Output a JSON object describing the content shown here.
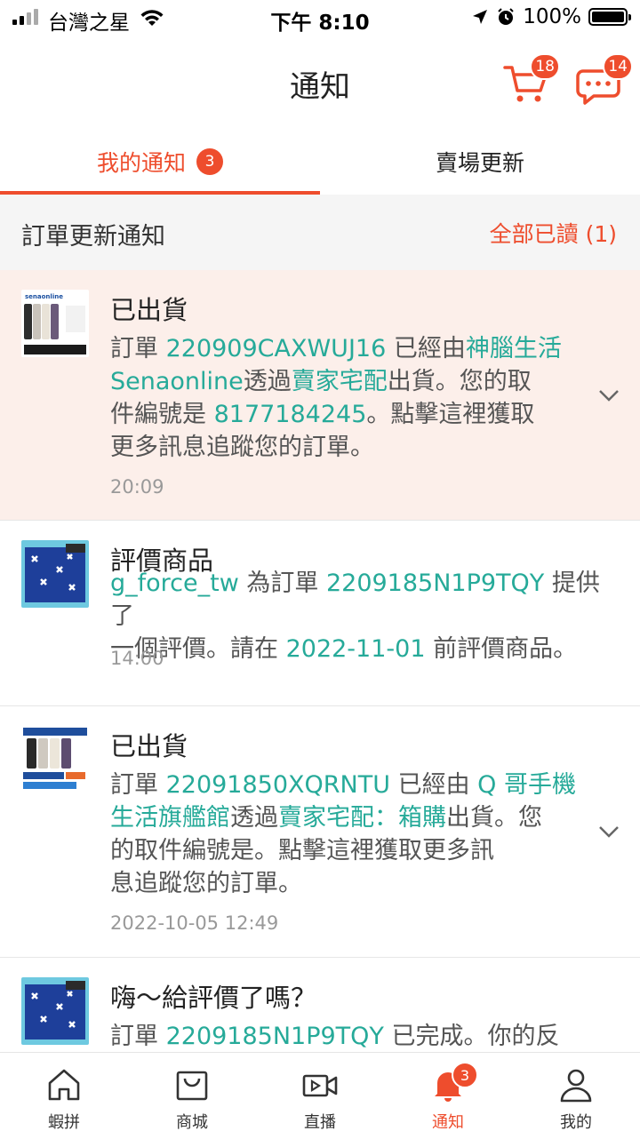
{
  "status_bar": {
    "carrier": "台灣之星",
    "time": "下午 8:10",
    "battery": "100%"
  },
  "header": {
    "title": "通知",
    "cart_badge": "18",
    "chat_badge": "14",
    "cart_icon": "cart-icon",
    "chat_icon": "chat-icon"
  },
  "tabs": [
    {
      "label": "我的通知",
      "badge": "3",
      "active": true
    },
    {
      "label": "賣場更新",
      "badge": "",
      "active": false
    }
  ],
  "section": {
    "title": "訂單更新通知",
    "mark_all_read": "全部已讀 (1)"
  },
  "notifications": [
    {
      "title": "已出貨",
      "body_lines": [
        [
          {
            "t": "訂單 "
          },
          {
            "t": "220909CAXWUJ16",
            "hl": true
          },
          {
            "t": " 已經由"
          },
          {
            "t": "神腦生活",
            "hl": true
          }
        ],
        [
          {
            "t": "Senaonline",
            "hl": true
          },
          {
            "t": "透過"
          },
          {
            "t": "賣家宅配",
            "hl": true
          },
          {
            "t": "出貨。您的取"
          }
        ],
        [
          {
            "t": "件編號是 "
          },
          {
            "t": "8177184245",
            "hl": true
          },
          {
            "t": "。點擊這裡獲取"
          }
        ],
        [
          {
            "t": "更多訊息追蹤您的訂單。"
          }
        ]
      ],
      "time": "20:09",
      "unread": true
    },
    {
      "title": "評價商品",
      "body_lines": [
        [
          {
            "t": "g_force_tw",
            "hl": true
          },
          {
            "t": " 為訂單 "
          },
          {
            "t": "2209185N1P9TQY",
            "hl": true
          },
          {
            "t": " 提供了"
          }
        ],
        [
          {
            "t": "一個評價。請在 "
          },
          {
            "t": "2022-11-01",
            "hl": true
          },
          {
            "t": " 前評價商品。"
          }
        ]
      ],
      "time": "14:00",
      "unread": false
    },
    {
      "title": "已出貨",
      "body_lines": [
        [
          {
            "t": "訂單 "
          },
          {
            "t": "22091850XQRNTU",
            "hl": true
          },
          {
            "t": " 已經由 "
          },
          {
            "t": "Q 哥手機",
            "hl": true
          }
        ],
        [
          {
            "t": "生活旗艦館",
            "hl": true
          },
          {
            "t": "透過"
          },
          {
            "t": "賣家宅配：箱購",
            "hl": true
          },
          {
            "t": "出貨。您"
          }
        ],
        [
          {
            "t": "的取件編號是。點擊這裡獲取更多訊"
          }
        ],
        [
          {
            "t": "息追蹤您的訂單。"
          }
        ]
      ],
      "time": "2022-10-05 12:49",
      "unread": false
    },
    {
      "title": "嗨～給評價了嗎？",
      "body_lines": [
        [
          {
            "t": "訂單 "
          },
          {
            "t": "2209185N1P9TQY",
            "hl": true
          },
          {
            "t": " 已完成。你的反"
          }
        ]
      ],
      "time": "",
      "unread": false
    }
  ],
  "bottom_nav": [
    {
      "label": "蝦拼",
      "icon": "home-icon"
    },
    {
      "label": "商城",
      "icon": "mall-bag-icon"
    },
    {
      "label": "直播",
      "icon": "live-video-icon"
    },
    {
      "label": "通知",
      "icon": "bell-icon",
      "badge": "3",
      "active": true
    },
    {
      "label": "我的",
      "icon": "profile-icon"
    }
  ],
  "colors": {
    "accent": "#ee4d2d",
    "link": "#26aa99",
    "unread_bg": "#fcefea"
  }
}
